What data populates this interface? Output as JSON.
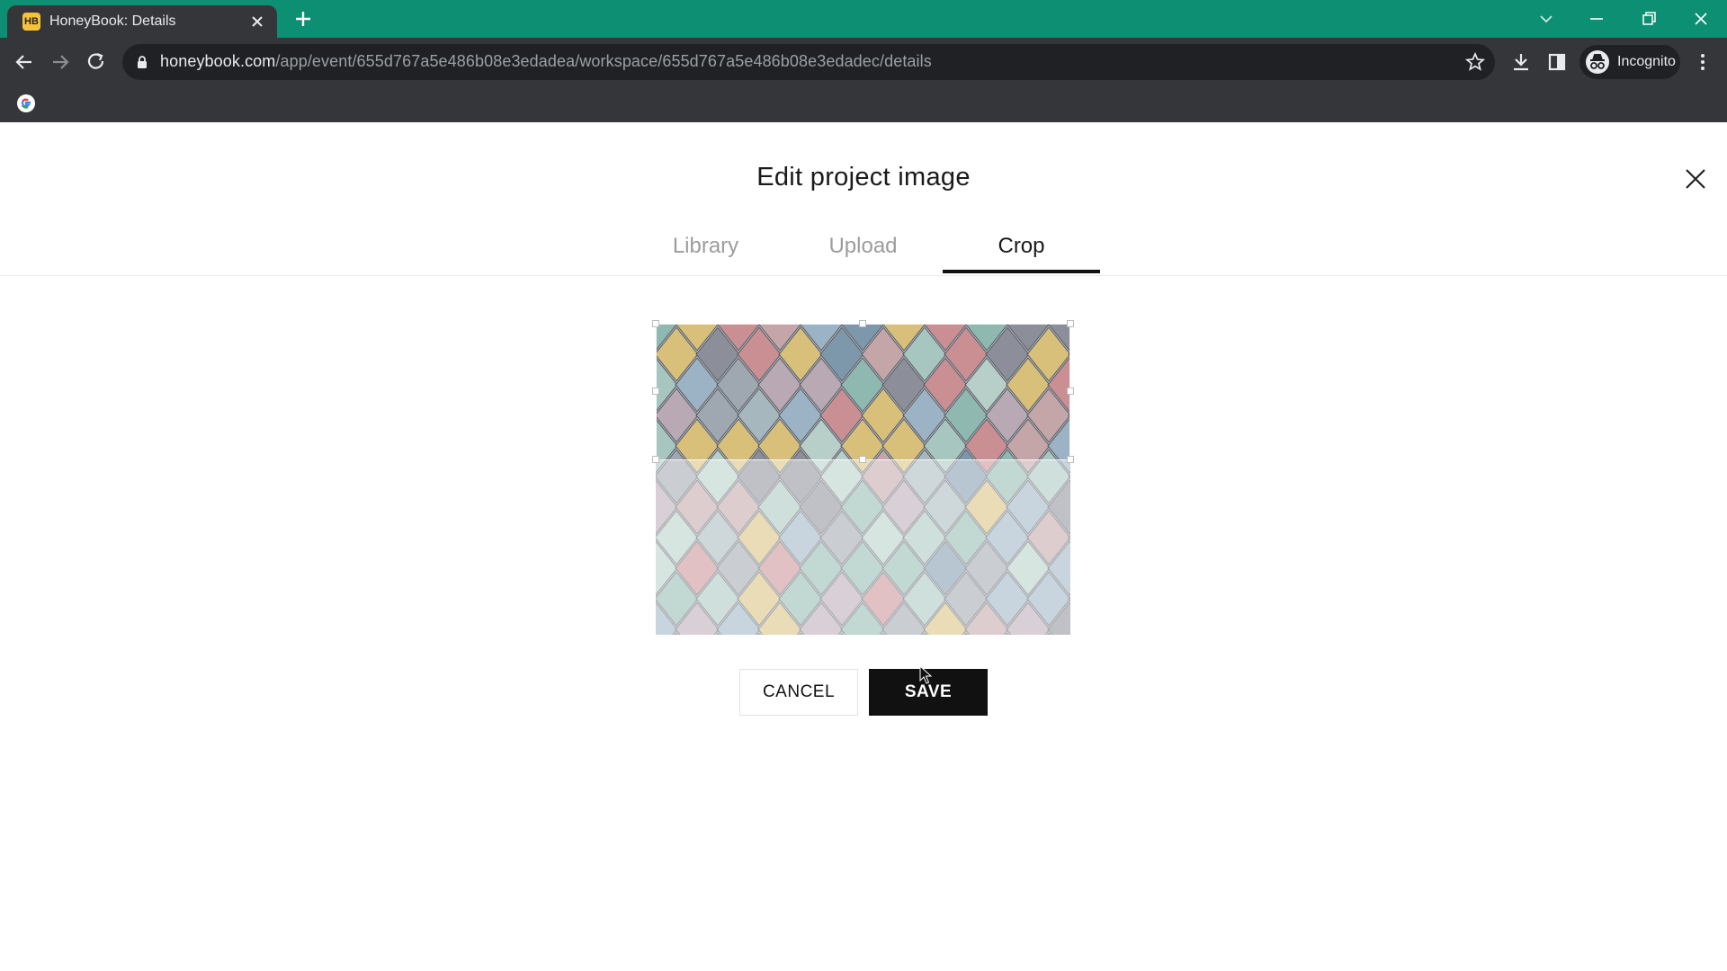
{
  "browser": {
    "tab_title": "HoneyBook: Details",
    "tab_favicon": "HB",
    "url_host": "honeybook.com",
    "url_path": "/app/event/655d767a5e486b08e3edadea/workspace/655d767a5e486b08e3edadec/details",
    "profile_label": "Incognito",
    "accent_color": "#0c8f72"
  },
  "modal": {
    "title": "Edit project image",
    "tabs": [
      {
        "label": "Library",
        "active": false
      },
      {
        "label": "Upload",
        "active": false
      },
      {
        "label": "Crop",
        "active": true
      }
    ],
    "cancel_label": "CANCEL",
    "save_label": "SAVE"
  },
  "icons": [
    "close-tab-icon",
    "new-tab-icon",
    "back-icon",
    "forward-icon",
    "reload-icon",
    "lock-icon",
    "star-icon",
    "download-icon",
    "side-panel-icon",
    "incognito-icon",
    "more-menu-icon",
    "google-icon",
    "close-icon",
    "chevron-down-icon",
    "minimize-icon",
    "restore-icon"
  ]
}
